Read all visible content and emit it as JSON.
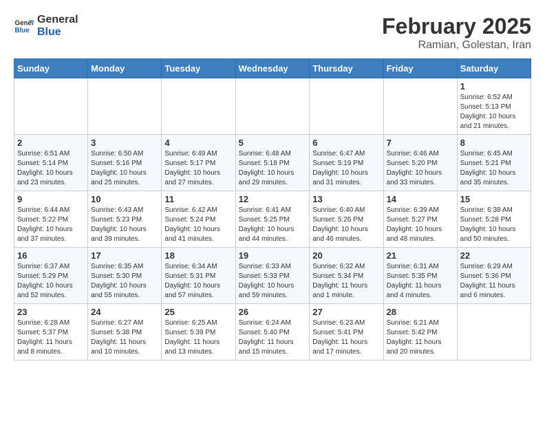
{
  "header": {
    "logo_line1": "General",
    "logo_line2": "Blue",
    "month_year": "February 2025",
    "location": "Ramian, Golestan, Iran"
  },
  "weekdays": [
    "Sunday",
    "Monday",
    "Tuesday",
    "Wednesday",
    "Thursday",
    "Friday",
    "Saturday"
  ],
  "weeks": [
    [
      {
        "day": "",
        "info": ""
      },
      {
        "day": "",
        "info": ""
      },
      {
        "day": "",
        "info": ""
      },
      {
        "day": "",
        "info": ""
      },
      {
        "day": "",
        "info": ""
      },
      {
        "day": "",
        "info": ""
      },
      {
        "day": "1",
        "info": "Sunrise: 6:52 AM\nSunset: 5:13 PM\nDaylight: 10 hours and 21 minutes."
      }
    ],
    [
      {
        "day": "2",
        "info": "Sunrise: 6:51 AM\nSunset: 5:14 PM\nDaylight: 10 hours and 23 minutes."
      },
      {
        "day": "3",
        "info": "Sunrise: 6:50 AM\nSunset: 5:16 PM\nDaylight: 10 hours and 25 minutes."
      },
      {
        "day": "4",
        "info": "Sunrise: 6:49 AM\nSunset: 5:17 PM\nDaylight: 10 hours and 27 minutes."
      },
      {
        "day": "5",
        "info": "Sunrise: 6:48 AM\nSunset: 5:18 PM\nDaylight: 10 hours and 29 minutes."
      },
      {
        "day": "6",
        "info": "Sunrise: 6:47 AM\nSunset: 5:19 PM\nDaylight: 10 hours and 31 minutes."
      },
      {
        "day": "7",
        "info": "Sunrise: 6:46 AM\nSunset: 5:20 PM\nDaylight: 10 hours and 33 minutes."
      },
      {
        "day": "8",
        "info": "Sunrise: 6:45 AM\nSunset: 5:21 PM\nDaylight: 10 hours and 35 minutes."
      }
    ],
    [
      {
        "day": "9",
        "info": "Sunrise: 6:44 AM\nSunset: 5:22 PM\nDaylight: 10 hours and 37 minutes."
      },
      {
        "day": "10",
        "info": "Sunrise: 6:43 AM\nSunset: 5:23 PM\nDaylight: 10 hours and 39 minutes."
      },
      {
        "day": "11",
        "info": "Sunrise: 6:42 AM\nSunset: 5:24 PM\nDaylight: 10 hours and 41 minutes."
      },
      {
        "day": "12",
        "info": "Sunrise: 6:41 AM\nSunset: 5:25 PM\nDaylight: 10 hours and 44 minutes."
      },
      {
        "day": "13",
        "info": "Sunrise: 6:40 AM\nSunset: 5:26 PM\nDaylight: 10 hours and 46 minutes."
      },
      {
        "day": "14",
        "info": "Sunrise: 6:39 AM\nSunset: 5:27 PM\nDaylight: 10 hours and 48 minutes."
      },
      {
        "day": "15",
        "info": "Sunrise: 6:38 AM\nSunset: 5:28 PM\nDaylight: 10 hours and 50 minutes."
      }
    ],
    [
      {
        "day": "16",
        "info": "Sunrise: 6:37 AM\nSunset: 5:29 PM\nDaylight: 10 hours and 52 minutes."
      },
      {
        "day": "17",
        "info": "Sunrise: 6:35 AM\nSunset: 5:30 PM\nDaylight: 10 hours and 55 minutes."
      },
      {
        "day": "18",
        "info": "Sunrise: 6:34 AM\nSunset: 5:31 PM\nDaylight: 10 hours and 57 minutes."
      },
      {
        "day": "19",
        "info": "Sunrise: 6:33 AM\nSunset: 5:33 PM\nDaylight: 10 hours and 59 minutes."
      },
      {
        "day": "20",
        "info": "Sunrise: 6:32 AM\nSunset: 5:34 PM\nDaylight: 11 hours and 1 minute."
      },
      {
        "day": "21",
        "info": "Sunrise: 6:31 AM\nSunset: 5:35 PM\nDaylight: 11 hours and 4 minutes."
      },
      {
        "day": "22",
        "info": "Sunrise: 6:29 AM\nSunset: 5:36 PM\nDaylight: 11 hours and 6 minutes."
      }
    ],
    [
      {
        "day": "23",
        "info": "Sunrise: 6:28 AM\nSunset: 5:37 PM\nDaylight: 11 hours and 8 minutes."
      },
      {
        "day": "24",
        "info": "Sunrise: 6:27 AM\nSunset: 5:38 PM\nDaylight: 11 hours and 10 minutes."
      },
      {
        "day": "25",
        "info": "Sunrise: 6:25 AM\nSunset: 5:39 PM\nDaylight: 11 hours and 13 minutes."
      },
      {
        "day": "26",
        "info": "Sunrise: 6:24 AM\nSunset: 5:40 PM\nDaylight: 11 hours and 15 minutes."
      },
      {
        "day": "27",
        "info": "Sunrise: 6:23 AM\nSunset: 5:41 PM\nDaylight: 11 hours and 17 minutes."
      },
      {
        "day": "28",
        "info": "Sunrise: 6:21 AM\nSunset: 5:42 PM\nDaylight: 11 hours and 20 minutes."
      },
      {
        "day": "",
        "info": ""
      }
    ]
  ]
}
